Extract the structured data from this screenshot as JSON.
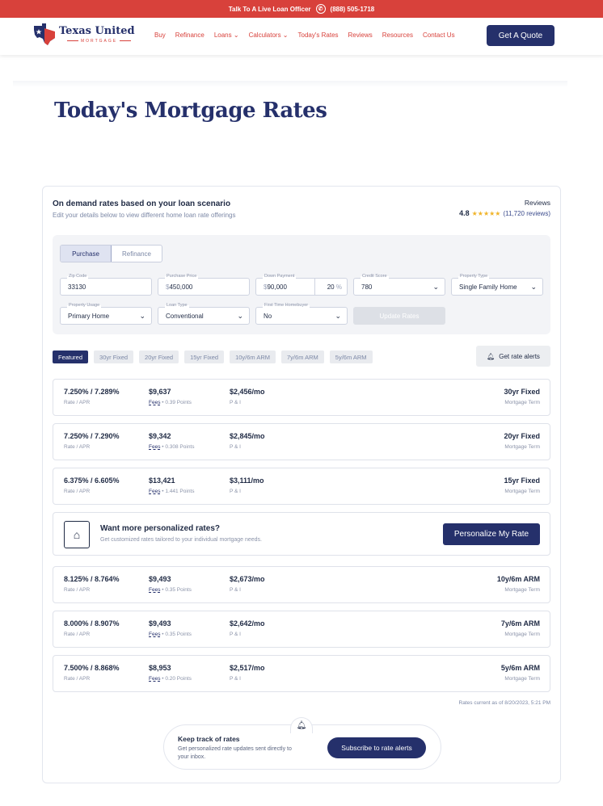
{
  "topbar": {
    "text": "Talk To A Live Loan Officer",
    "phone": "(888) 505-1718"
  },
  "logo": {
    "name": "Texas United",
    "sub": "MORTGAGE"
  },
  "nav": {
    "links": [
      "Buy",
      "Refinance",
      "Loans ⌄",
      "Calculators ⌄",
      "Today's Rates",
      "Reviews",
      "Resources",
      "Contact Us"
    ],
    "cta": "Get A Quote"
  },
  "page": {
    "title": "Today's Mortgage Rates"
  },
  "card": {
    "title": "On demand rates based on your loan scenario",
    "subtitle": "Edit your details below to view different home loan rate offerings",
    "reviews_label": "Reviews",
    "rating": "4.8",
    "stars": "★★★★★",
    "review_count": "(11,720 reviews)"
  },
  "form": {
    "tabs": [
      "Purchase",
      "Refinance"
    ],
    "zip": {
      "label": "Zip Code",
      "value": "33130"
    },
    "price": {
      "label": "Purchase Price",
      "prefix": "$",
      "value": "450,000"
    },
    "down": {
      "label": "Down Payment",
      "prefix": "$",
      "value": "90,000",
      "pct": "20",
      "pct_sign": "%"
    },
    "credit": {
      "label": "Credit Score",
      "value": "780"
    },
    "ptype": {
      "label": "Property Type",
      "value": "Single Family Home"
    },
    "usage": {
      "label": "Property Usage",
      "value": "Primary Home"
    },
    "loan": {
      "label": "Loan Type",
      "value": "Conventional"
    },
    "first": {
      "label": "First Time Homebuyer",
      "value": "No"
    },
    "update": "Update Rates"
  },
  "filters": [
    "Featured",
    "30yr Fixed",
    "20yr Fixed",
    "15yr Fixed",
    "10y/6m ARM",
    "7y/6m ARM",
    "5y/6m ARM"
  ],
  "alerts_button": "Get rate alerts",
  "rates": [
    {
      "rate": "7.250% / 7.289%",
      "cost": "$9,637",
      "points": "• 0.39 Points",
      "payment": "$2,456/mo",
      "term": "30yr Fixed"
    },
    {
      "rate": "7.250% / 7.290%",
      "cost": "$9,342",
      "points": "• 0.308 Points",
      "payment": "$2,845/mo",
      "term": "20yr Fixed"
    },
    {
      "rate": "6.375% / 6.605%",
      "cost": "$13,421",
      "points": "• 1.441 Points",
      "payment": "$3,111/mo",
      "term": "15yr Fixed"
    },
    {
      "rate": "8.125% / 8.764%",
      "cost": "$9,493",
      "points": "• 0.35 Points",
      "payment": "$2,673/mo",
      "term": "10y/6m ARM"
    },
    {
      "rate": "8.000% / 8.907%",
      "cost": "$9,493",
      "points": "• 0.35 Points",
      "payment": "$2,642/mo",
      "term": "7y/6m ARM"
    },
    {
      "rate": "7.500% / 8.868%",
      "cost": "$8,953",
      "points": "• 0.20 Points",
      "payment": "$2,517/mo",
      "term": "5y/6m ARM"
    }
  ],
  "labels": {
    "rate_apr": "Rate / APR",
    "fees": "Fees",
    "pi": "P & I",
    "term": "Mortgage Term"
  },
  "promo": {
    "title": "Want more personalized rates?",
    "subtitle": "Get customized rates tailored to your individual mortgage needs.",
    "button": "Personalize My Rate"
  },
  "rates_current": "Rates current as of 8/20/2023, 5:21 PM",
  "track": {
    "title": "Keep track of rates",
    "subtitle": "Get personalized rate updates sent directly to your inbox.",
    "button": "Subscribe to rate alerts"
  },
  "colors": {
    "brand_navy": "#25306b",
    "brand_red": "#d8413b",
    "star": "#f0b429"
  }
}
